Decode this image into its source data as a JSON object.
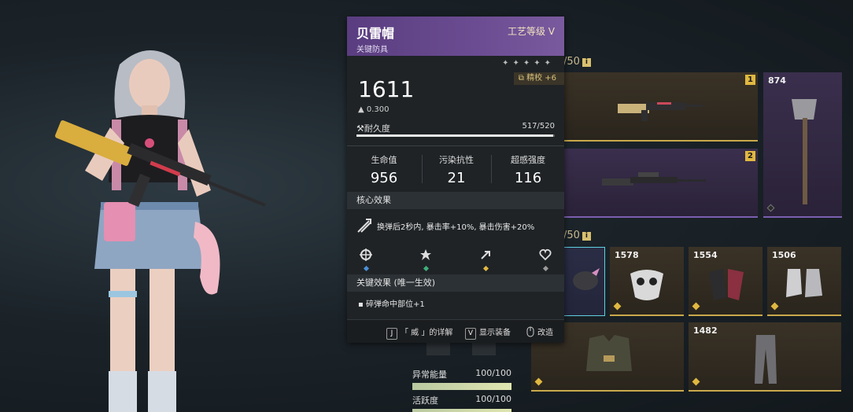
{
  "inventory": {
    "weapon_capacity": "/50",
    "armor_capacity": "/50",
    "weapons": [
      {
        "slot": "1"
      },
      {
        "slot": "2"
      }
    ],
    "melee_value": "874",
    "armor": [
      {
        "value": "1578"
      },
      {
        "value": "1554"
      },
      {
        "value": "1506"
      },
      {
        "value": "1482"
      }
    ]
  },
  "attributes": [
    {
      "label": "异常能量",
      "value": "100/100",
      "fill": 1.0
    },
    {
      "label": "活跃度",
      "value": "100/100",
      "fill": 1.0
    }
  ],
  "tooltip": {
    "name": "贝雷帽",
    "type": "关键防具",
    "rank": "工艺等级 V",
    "stars": "✦✦✦✦✦",
    "refine": "精校 +6",
    "power": "1611",
    "weight": "0.300",
    "durability_label": "耐久度",
    "durability_value": "517/520",
    "durability_fraction": 0.994,
    "stats": [
      {
        "label": "生命值",
        "value": "956"
      },
      {
        "label": "污染抗性",
        "value": "21"
      },
      {
        "label": "超感强度",
        "value": "116"
      }
    ],
    "core_title": "核心效果",
    "core_text": "换弹后2秒内, 暴击率+10%, 暴击伤害+20%",
    "key_title": "关键效果 (唯一生效)",
    "key_text": "▪  碎弹命中部位+1",
    "footer": {
      "key_j": "J",
      "detail_label": "「 威 」的详解",
      "key_v": "V",
      "show_label": "显示装备",
      "modify_label": "改造"
    }
  },
  "colors": {
    "accent_purple": "#6b4c92",
    "accent_gold": "#c9a94a",
    "dot_blue": "#4a8fd8",
    "dot_green": "#3fae7a",
    "dot_gold": "#e0b840",
    "dot_gray": "#9a9a9a"
  }
}
